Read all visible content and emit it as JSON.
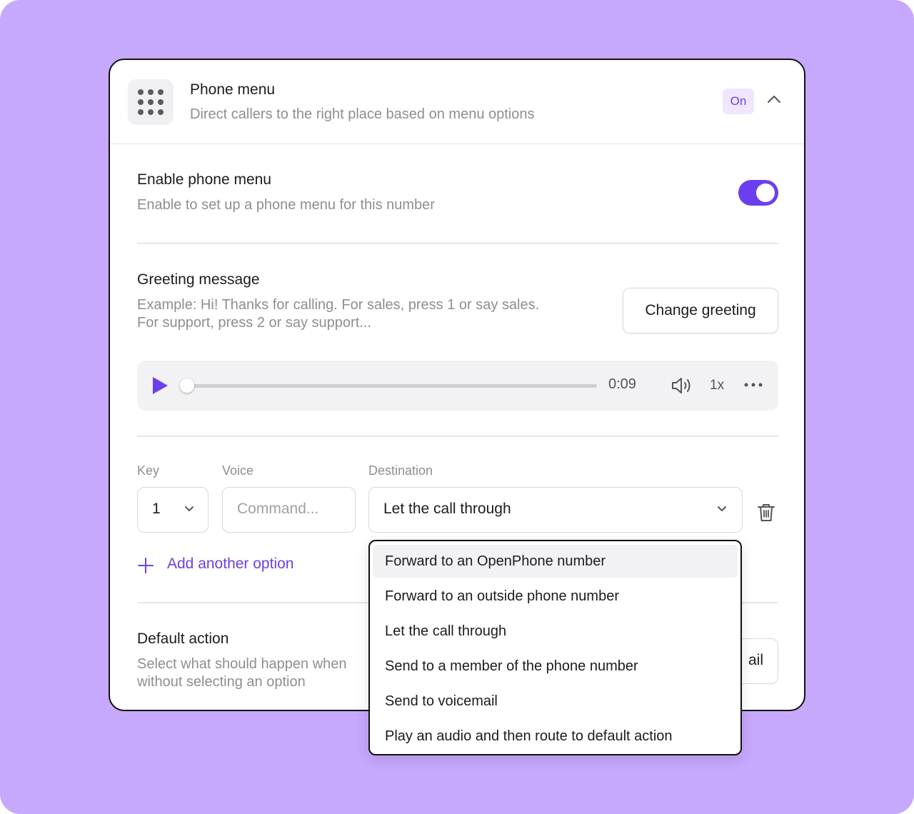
{
  "header": {
    "title": "Phone menu",
    "subtitle": "Direct callers to the right place based on menu options",
    "status_badge": "On"
  },
  "enable": {
    "title": "Enable phone menu",
    "subtitle": "Enable to set up a phone menu for this number",
    "enabled": true
  },
  "greeting": {
    "title": "Greeting message",
    "example_line1": "Example: Hi! Thanks for calling. For sales, press 1 or say sales.",
    "example_line2": "For support, press 2 or say support...",
    "change_button": "Change greeting"
  },
  "player": {
    "time": "0:09",
    "speed": "1x",
    "progress": 0.0
  },
  "options": {
    "key_label": "Key",
    "voice_label": "Voice",
    "destination_label": "Destination",
    "key_value": "1",
    "voice_placeholder": "Command...",
    "destination_value": "Let the call through",
    "add_label": "Add another option"
  },
  "default_action": {
    "title": "Default action",
    "subtitle_line1": "Select what should happen when",
    "subtitle_line2": "without selecting an option",
    "button_partial": "ail"
  },
  "dropdown": {
    "items": [
      "Forward to an OpenPhone number",
      "Forward to an outside phone number",
      "Let the call through",
      "Send to a member of the phone number",
      "Send to voicemail",
      "Play an audio and then route to default action"
    ],
    "highlighted_index": 0
  },
  "colors": {
    "background": "#c6a8fd",
    "accent": "#6b3ff0",
    "badge_bg": "#efe6ff"
  },
  "icons": [
    "dialpad-icon",
    "chevron-up-icon",
    "play-icon",
    "volume-icon",
    "more-icon",
    "chevron-down-icon",
    "trash-icon",
    "plus-icon"
  ]
}
